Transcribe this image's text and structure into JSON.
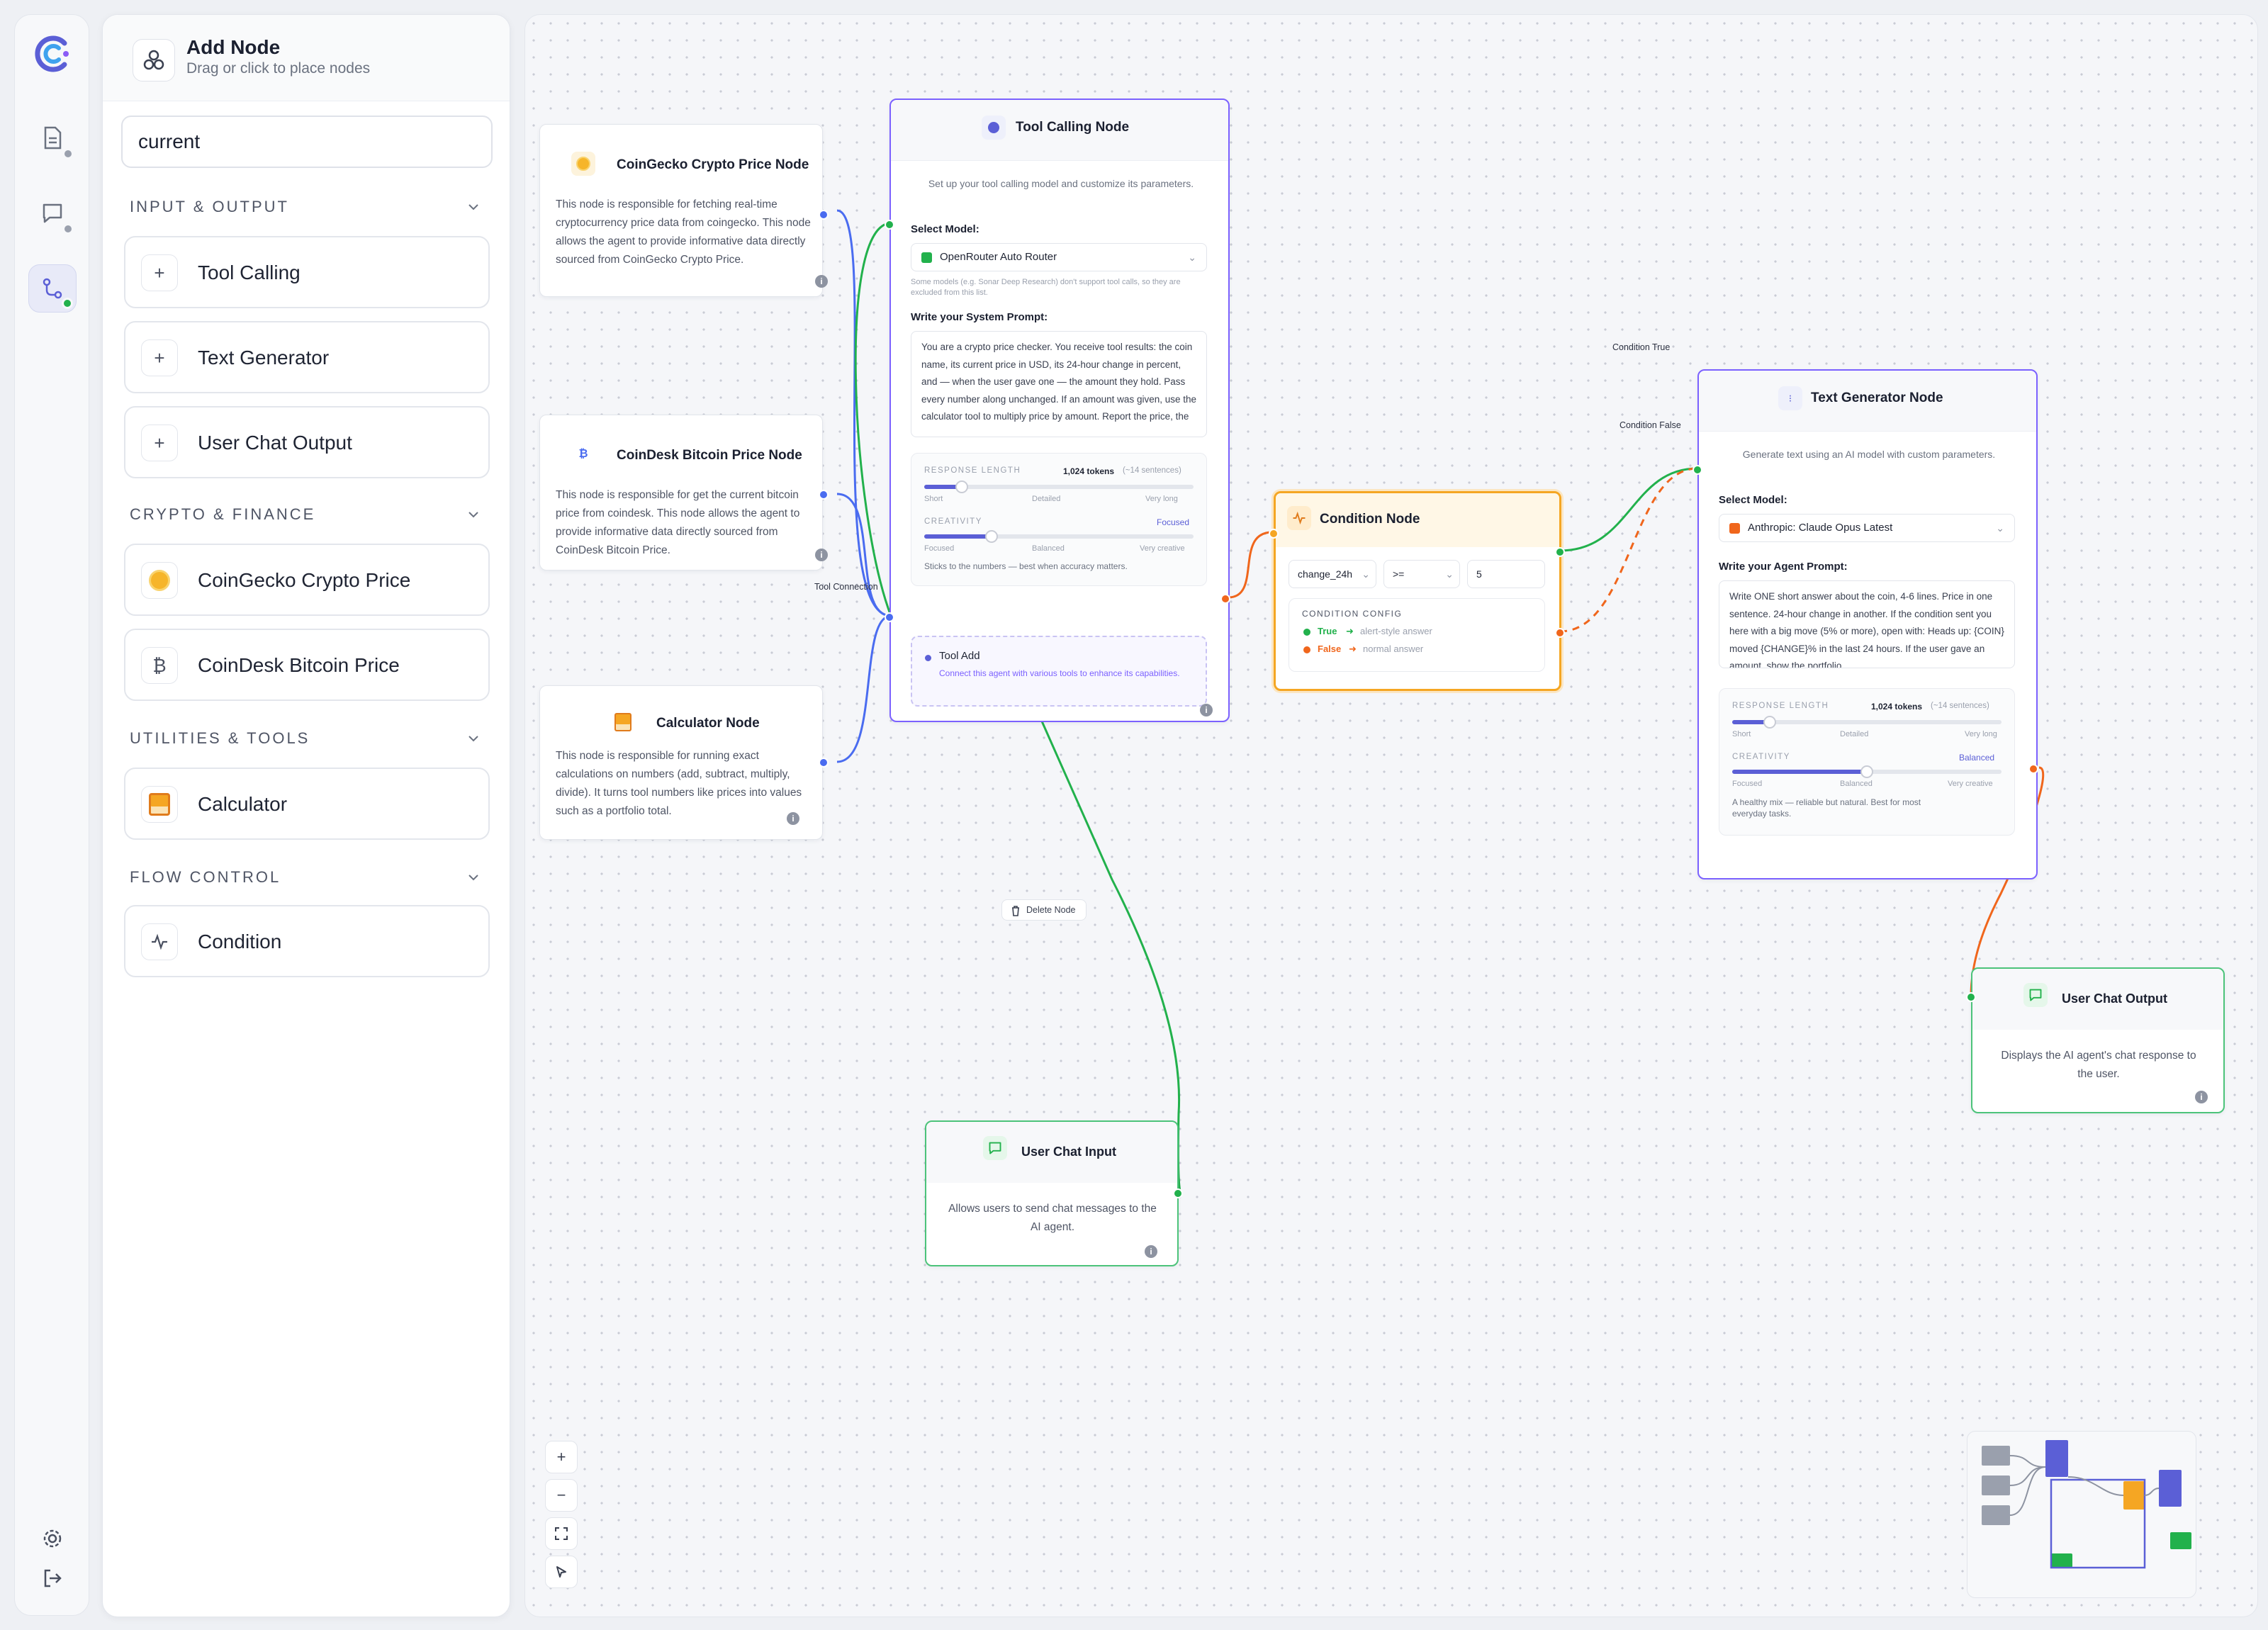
{
  "rail": {
    "items": [
      {
        "icon": "document-icon",
        "label": ""
      },
      {
        "icon": "chat-icon",
        "label": ""
      },
      {
        "icon": "workflow-icon",
        "label": ""
      }
    ],
    "bottom": [
      {
        "icon": "gear-icon"
      },
      {
        "icon": "logout-icon"
      }
    ]
  },
  "panel": {
    "title": "Add Node",
    "subtitle": "Drag or click to place nodes",
    "search_value": "current",
    "sections": [
      {
        "title": "INPUT & OUTPUT",
        "items": [
          "Tool Calling",
          "Text Generator",
          "User Chat Output"
        ]
      },
      {
        "title": "CRYPTO & FINANCE",
        "items": [
          "CoinGecko Crypto Price",
          "CoinDesk Bitcoin Price"
        ]
      },
      {
        "title": "UTILITIES & TOOLS",
        "items": [
          "Calculator"
        ]
      },
      {
        "title": "FLOW CONTROL",
        "items": [
          "Condition"
        ]
      }
    ]
  },
  "nodes": {
    "coingecko": {
      "title": "CoinGecko Crypto Price Node",
      "description": "This node is responsible for fetching real-time cryptocurrency price data from coingecko. This node allows the agent to provide informative data directly sourced from CoinGecko Crypto Price."
    },
    "coindesk": {
      "title": "CoinDesk Bitcoin Price Node",
      "description": "This node is responsible for get the current bitcoin price from coindesk. This node allows the agent to provide informative data directly sourced from CoinDesk Bitcoin Price."
    },
    "calculator": {
      "title": "Calculator Node",
      "description": "This node is responsible for running exact calculations on numbers (add, subtract, multiply, divide). It turns tool numbers like prices into values such as a portfolio total."
    },
    "tool_calling": {
      "title": "Tool Calling Node",
      "subtitle": "Set up your tool calling model and customize its parameters.",
      "select_model_label": "Select Model:",
      "model": "OpenRouter Auto Router",
      "model_note": "Some models (e.g. Sonar Deep Research) don't support tool calls, so they are excluded from this list.",
      "prompt_label": "Write your System Prompt:",
      "prompt": "You are a crypto price checker. You receive tool results: the coin name, its current price in USD, its 24-hour change in percent, and — when the user gave one — the amount they hold. Pass every number along unchanged. If an amount was given, use the calculator tool to multiply price by amount. Report the price, the",
      "response_length_label": "RESPONSE LENGTH",
      "response_length_value": "1,024 tokens",
      "response_length_hint": "(~14 sentences)",
      "rl_ticks": [
        "Short",
        "Detailed",
        "Very long"
      ],
      "response_length_fraction": 0.14,
      "creativity_label": "CREATIVITY",
      "creativity_value": "Focused",
      "cr_ticks": [
        "Focused",
        "Balanced",
        "Very creative"
      ],
      "creativity_fraction": 0.25,
      "creativity_note": "Sticks to the numbers — best when accuracy matters.",
      "tool_add_title": "Tool Add",
      "tool_add_desc": "Connect this agent with various tools to enhance its capabilities."
    },
    "condition": {
      "title": "Condition Node",
      "field": "change_24h",
      "operator": ">=",
      "value": "5",
      "config_label": "CONDITION CONFIG",
      "true_label": "True",
      "true_desc": "alert-style answer",
      "false_label": "False",
      "false_desc": "normal answer"
    },
    "text_generator": {
      "title": "Text Generator Node",
      "subtitle": "Generate text using an AI model with custom parameters.",
      "select_model_label": "Select Model:",
      "model": "Anthropic: Claude Opus Latest",
      "prompt_label": "Write your Agent Prompt:",
      "prompt": "Write ONE short answer about the coin, 4-6 lines. Price in one sentence. 24-hour change in another. If the condition sent you here with a big move (5% or more), open with: Heads up: {COIN} moved {CHANGE}% in the last 24 hours. If the user gave an amount, show the portfolio",
      "response_length_label": "RESPONSE LENGTH",
      "response_length_value": "1,024 tokens",
      "response_length_hint": "(~14 sentences)",
      "rl_ticks": [
        "Short",
        "Detailed",
        "Very long"
      ],
      "response_length_fraction": 0.14,
      "creativity_label": "CREATIVITY",
      "creativity_value": "Balanced",
      "cr_ticks": [
        "Focused",
        "Balanced",
        "Very creative"
      ],
      "creativity_fraction": 0.5,
      "creativity_note": "A healthy mix — reliable but natural. Best for most everyday tasks."
    },
    "user_chat_input": {
      "title": "User Chat Input",
      "description": "Allows users to send chat messages to the AI agent."
    },
    "user_chat_output": {
      "title": "User Chat Output",
      "description": "Displays the AI agent's chat response to the user."
    }
  },
  "edge_labels": {
    "tool_connection": "Tool Connection",
    "condition_true": "Condition True",
    "condition_false": "Condition False"
  },
  "delete_node": "Delete Node",
  "colors": {
    "accent": "#5b5fd6",
    "tool_edge": "#4a6cf0",
    "green_edge": "#22b14c",
    "orange_edge": "#f0661c",
    "condition_border": "#f5a623",
    "node_purple": "#7b61ff"
  }
}
